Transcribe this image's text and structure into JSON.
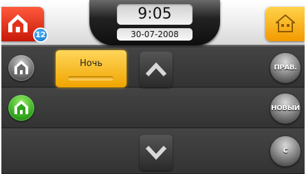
{
  "clock": {
    "time": "9:05",
    "date": "30-07-2008"
  },
  "header": {
    "notification_count": "12"
  },
  "mode": {
    "label": "Ночь"
  },
  "right_buttons": {
    "edit": "ПРАВ.",
    "new": "НОВЫЙ",
    "clear": "C"
  },
  "colors": {
    "alert": "#e8301a",
    "accent_yellow": "#f7b321",
    "active_green": "#3cb521",
    "badge_blue": "#1a8de0",
    "background": "#383838"
  },
  "icons": {
    "top_left": "house-outline-icon",
    "top_right": "house-icon",
    "row1_left": "house-outline-icon",
    "row2_left": "house-icon",
    "scroll_up": "chevron-up-icon",
    "scroll_down": "chevron-down-icon"
  }
}
